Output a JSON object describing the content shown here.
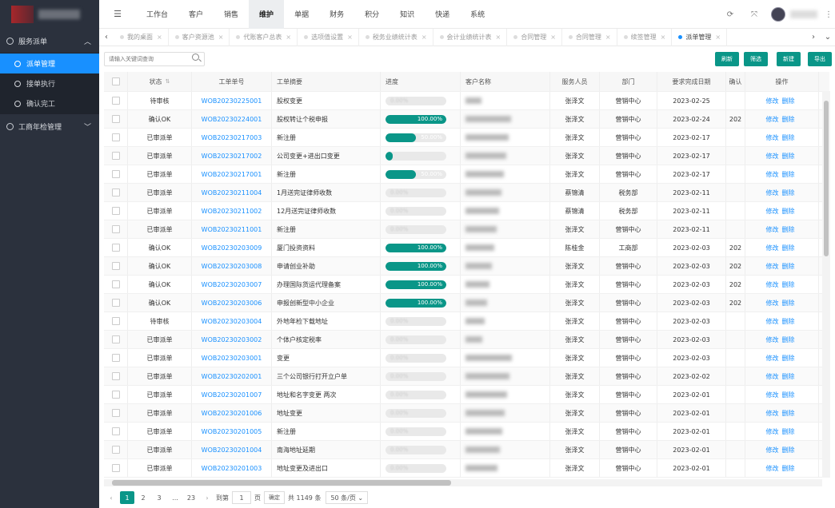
{
  "sidebar": {
    "groups": [
      {
        "label": "服务派单",
        "items": [
          "派单管理",
          "接单执行",
          "确认完工"
        ],
        "active_item": 0
      },
      {
        "label": "工商年检管理"
      }
    ]
  },
  "topnav": {
    "items": [
      "工作台",
      "客户",
      "销售",
      "维护",
      "单据",
      "财务",
      "积分",
      "知识",
      "快递",
      "系统"
    ],
    "active": 3
  },
  "tabs": [
    "我的桌面",
    "客户资源池",
    "代账客户总表",
    "选项值设置",
    "税务业绩统计表",
    "会计业绩统计表",
    "合同管理",
    "合同管理",
    "续签管理",
    "派单管理"
  ],
  "active_tab": 9,
  "search": {
    "placeholder": "请输入关键词查询"
  },
  "buttons": {
    "refresh": "刷新",
    "filter": "筛选",
    "new": "新建",
    "export": "导出"
  },
  "table": {
    "headers": [
      "状态",
      "工单单号",
      "工单摘要",
      "进度",
      "客户名称",
      "服务人员",
      "部门",
      "要求完成日期",
      "确认",
      "操作"
    ],
    "action_edit": "修改",
    "action_delete": "删除",
    "rows": [
      {
        "status": "待审核",
        "order": "WOB20230225001",
        "summary": "股权变更",
        "progress": 0,
        "staff": "张泽文",
        "dept": "营销中心",
        "date": "2023-02-25",
        "confirm": ""
      },
      {
        "status": "确认OK",
        "order": "WOB20230224001",
        "summary": "股权转让个税申报",
        "progress": 100,
        "staff": "张泽文",
        "dept": "营销中心",
        "date": "2023-02-24",
        "confirm": "202"
      },
      {
        "status": "已审派单",
        "order": "WOB20230217003",
        "summary": "新注册",
        "progress": 50,
        "staff": "张泽文",
        "dept": "营销中心",
        "date": "2023-02-17",
        "confirm": ""
      },
      {
        "status": "已审派单",
        "order": "WOB20230217002",
        "summary": "公司变更+进出口变更",
        "progress": 5,
        "staff": "张泽文",
        "dept": "营销中心",
        "date": "2023-02-17",
        "confirm": ""
      },
      {
        "status": "已审派单",
        "order": "WOB20230217001",
        "summary": "新注册",
        "progress": 50,
        "staff": "张泽文",
        "dept": "营销中心",
        "date": "2023-02-17",
        "confirm": ""
      },
      {
        "status": "已审派单",
        "order": "WOB20230211004",
        "summary": "1月送完证律师收数",
        "progress": 0,
        "staff": "蔡锦清",
        "dept": "税务部",
        "date": "2023-02-11",
        "confirm": ""
      },
      {
        "status": "已审派单",
        "order": "WOB20230211002",
        "summary": "12月送完证律师收数",
        "progress": 0,
        "staff": "蔡锦清",
        "dept": "税务部",
        "date": "2023-02-11",
        "confirm": ""
      },
      {
        "status": "已审派单",
        "order": "WOB20230211001",
        "summary": "新注册",
        "progress": 0,
        "staff": "张泽文",
        "dept": "营销中心",
        "date": "2023-02-11",
        "confirm": ""
      },
      {
        "status": "确认OK",
        "order": "WOB20230203009",
        "summary": "厦门投资资料",
        "progress": 100,
        "staff": "陈桂金",
        "dept": "工商部",
        "date": "2023-02-03",
        "confirm": "202"
      },
      {
        "status": "确认OK",
        "order": "WOB20230203008",
        "summary": "申请创业补助",
        "progress": 100,
        "staff": "张泽文",
        "dept": "营销中心",
        "date": "2023-02-03",
        "confirm": "202"
      },
      {
        "status": "确认OK",
        "order": "WOB20230203007",
        "summary": "办理国际货运代理备案",
        "progress": 100,
        "staff": "张泽文",
        "dept": "营销中心",
        "date": "2023-02-03",
        "confirm": "202"
      },
      {
        "status": "确认OK",
        "order": "WOB20230203006",
        "summary": "申报创新型中小企业",
        "progress": 100,
        "staff": "张泽文",
        "dept": "营销中心",
        "date": "2023-02-03",
        "confirm": "202"
      },
      {
        "status": "待审核",
        "order": "WOB20230203004",
        "summary": "外地年检下载地址",
        "progress": 0,
        "staff": "张泽文",
        "dept": "营销中心",
        "date": "2023-02-03",
        "confirm": ""
      },
      {
        "status": "已审派单",
        "order": "WOB20230203002",
        "summary": "个体户核定税率",
        "progress": 0,
        "staff": "张泽文",
        "dept": "营销中心",
        "date": "2023-02-03",
        "confirm": ""
      },
      {
        "status": "已审派单",
        "order": "WOB20230203001",
        "summary": "变更",
        "progress": 0,
        "staff": "张泽文",
        "dept": "营销中心",
        "date": "2023-02-03",
        "confirm": ""
      },
      {
        "status": "已审派单",
        "order": "WOB20230202001",
        "summary": "三个公司银行打开立户单",
        "progress": 0,
        "staff": "张泽文",
        "dept": "营销中心",
        "date": "2023-02-02",
        "confirm": ""
      },
      {
        "status": "已审派单",
        "order": "WOB20230201007",
        "summary": "地址和名字变更 两次",
        "progress": 0,
        "staff": "张泽文",
        "dept": "营销中心",
        "date": "2023-02-01",
        "confirm": ""
      },
      {
        "status": "已审派单",
        "order": "WOB20230201006",
        "summary": "地址变更",
        "progress": 0,
        "staff": "张泽文",
        "dept": "营销中心",
        "date": "2023-02-01",
        "confirm": ""
      },
      {
        "status": "已审派单",
        "order": "WOB20230201005",
        "summary": "新注册",
        "progress": 0,
        "staff": "张泽文",
        "dept": "营销中心",
        "date": "2023-02-01",
        "confirm": ""
      },
      {
        "status": "已审派单",
        "order": "WOB20230201004",
        "summary": "南海地址延期",
        "progress": 0,
        "staff": "张泽文",
        "dept": "营销中心",
        "date": "2023-02-01",
        "confirm": ""
      },
      {
        "status": "已审派单",
        "order": "WOB20230201003",
        "summary": "地址变更及进出口",
        "progress": 0,
        "staff": "张泽文",
        "dept": "营销中心",
        "date": "2023-02-01",
        "confirm": ""
      }
    ]
  },
  "pager": {
    "pages": [
      "1",
      "2",
      "3",
      "...",
      "23"
    ],
    "goto_prefix": "到第",
    "goto_value": "1",
    "goto_suffix": "页",
    "confirm": "确定",
    "total": "共 1149 条",
    "page_size": "50 条/页"
  },
  "colors": {
    "accent": "#0a9688",
    "link": "#1890ff",
    "sidebar": "#2b313d"
  }
}
